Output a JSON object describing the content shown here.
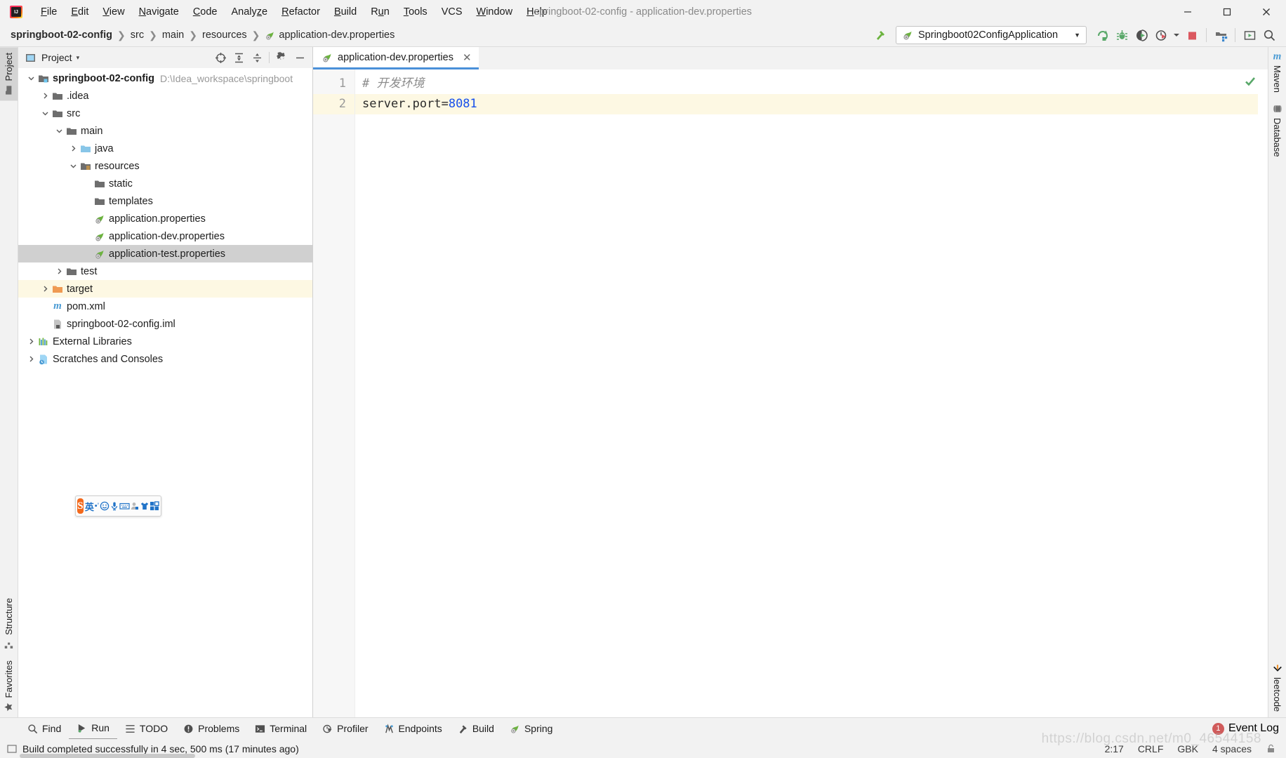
{
  "window": {
    "title": "springboot-02-config - application-dev.properties",
    "controls": {
      "minimize": "—",
      "maximize": "❐",
      "close": "✕"
    }
  },
  "menubar": [
    {
      "label": "File",
      "mnemonic": "F"
    },
    {
      "label": "Edit",
      "mnemonic": "E"
    },
    {
      "label": "View",
      "mnemonic": "V"
    },
    {
      "label": "Navigate",
      "mnemonic": "N"
    },
    {
      "label": "Code",
      "mnemonic": "C"
    },
    {
      "label": "Analyze",
      "mnemonic": "z"
    },
    {
      "label": "Refactor",
      "mnemonic": "R"
    },
    {
      "label": "Build",
      "mnemonic": "B"
    },
    {
      "label": "Run",
      "mnemonic": "u"
    },
    {
      "label": "Tools",
      "mnemonic": "T"
    },
    {
      "label": "VCS",
      "mnemonic": ""
    },
    {
      "label": "Window",
      "mnemonic": "W"
    },
    {
      "label": "Help",
      "mnemonic": "H"
    }
  ],
  "breadcrumb": [
    {
      "label": "springboot-02-config",
      "bold": true,
      "icon": ""
    },
    {
      "label": "src",
      "bold": false,
      "icon": ""
    },
    {
      "label": "main",
      "bold": false,
      "icon": ""
    },
    {
      "label": "resources",
      "bold": false,
      "icon": ""
    },
    {
      "label": "application-dev.properties",
      "bold": false,
      "icon": "spring-leaf-icon"
    }
  ],
  "toolbar": {
    "build_hammer": "build-hammer-icon",
    "run_config_name": "Springboot02ConfigApplication",
    "run_config_icon": "spring-leaf-icon",
    "dropdown_caret": "▼",
    "buttons": [
      {
        "name": "rerun-icon",
        "label": "Rerun"
      },
      {
        "name": "debug-icon",
        "label": "Debug"
      },
      {
        "name": "run-coverage-icon",
        "label": "Run with Coverage"
      },
      {
        "name": "profiler-icon",
        "label": "Profile"
      },
      {
        "name": "stop-icon",
        "label": "Stop"
      },
      {
        "name": "project-structure-icon",
        "label": "Project Structure"
      },
      {
        "name": "updates-icon",
        "label": "Updates"
      },
      {
        "name": "search-everywhere-icon",
        "label": "Search Everywhere"
      }
    ]
  },
  "left_tool_tabs": [
    {
      "label": "Project",
      "icon": "folder-icon",
      "active": true
    },
    {
      "label": "Structure",
      "icon": "structure-icon",
      "active": false
    },
    {
      "label": "Favorites",
      "icon": "star-icon",
      "active": false
    }
  ],
  "right_tool_tabs": [
    {
      "label": "Maven",
      "icon": "maven-m-icon"
    },
    {
      "label": "Database",
      "icon": "database-icon"
    },
    {
      "label": "leetcode",
      "icon": "leetcode-icon"
    }
  ],
  "project_panel": {
    "title": "Project",
    "title_caret": "▾",
    "icons": [
      {
        "name": "select-opened-file-icon"
      },
      {
        "name": "expand-all-icon"
      },
      {
        "name": "collapse-all-icon"
      },
      {
        "name": "gear-icon"
      },
      {
        "name": "hide-icon"
      }
    ],
    "tree": [
      {
        "depth": 0,
        "arrow": "down",
        "icon": "module-icon",
        "label": "springboot-02-config",
        "bold": true,
        "path": "D:\\Idea_workspace\\springboot",
        "state": ""
      },
      {
        "depth": 1,
        "arrow": "right",
        "icon": "folder-icon",
        "label": ".idea",
        "bold": false,
        "path": "",
        "state": ""
      },
      {
        "depth": 1,
        "arrow": "down",
        "icon": "folder-icon",
        "label": "src",
        "bold": false,
        "path": "",
        "state": ""
      },
      {
        "depth": 2,
        "arrow": "down",
        "icon": "folder-icon",
        "label": "main",
        "bold": false,
        "path": "",
        "state": ""
      },
      {
        "depth": 3,
        "arrow": "right",
        "icon": "source-folder-icon",
        "label": "java",
        "bold": false,
        "path": "",
        "state": ""
      },
      {
        "depth": 3,
        "arrow": "down",
        "icon": "resource-folder-icon",
        "label": "resources",
        "bold": false,
        "path": "",
        "state": ""
      },
      {
        "depth": 4,
        "arrow": "",
        "icon": "folder-icon",
        "label": "static",
        "bold": false,
        "path": "",
        "state": ""
      },
      {
        "depth": 4,
        "arrow": "",
        "icon": "folder-icon",
        "label": "templates",
        "bold": false,
        "path": "",
        "state": ""
      },
      {
        "depth": 4,
        "arrow": "",
        "icon": "spring-leaf-icon",
        "label": "application.properties",
        "bold": false,
        "path": "",
        "state": ""
      },
      {
        "depth": 4,
        "arrow": "",
        "icon": "spring-leaf-icon",
        "label": "application-dev.properties",
        "bold": false,
        "path": "",
        "state": ""
      },
      {
        "depth": 4,
        "arrow": "",
        "icon": "spring-leaf-icon",
        "label": "application-test.properties",
        "bold": false,
        "path": "",
        "state": "selected"
      },
      {
        "depth": 2,
        "arrow": "right",
        "icon": "folder-icon",
        "label": "test",
        "bold": false,
        "path": "",
        "state": ""
      },
      {
        "depth": 1,
        "arrow": "right",
        "icon": "target-folder-icon",
        "label": "target",
        "bold": false,
        "path": "",
        "state": "highlight"
      },
      {
        "depth": 1,
        "arrow": "",
        "icon": "maven-m-icon",
        "label": "pom.xml",
        "bold": false,
        "path": "",
        "state": ""
      },
      {
        "depth": 1,
        "arrow": "",
        "icon": "iml-file-icon",
        "label": "springboot-02-config.iml",
        "bold": false,
        "path": "",
        "state": ""
      },
      {
        "depth": 0,
        "arrow": "right",
        "icon": "libraries-icon",
        "label": "External Libraries",
        "bold": false,
        "path": "",
        "state": ""
      },
      {
        "depth": 0,
        "arrow": "right",
        "icon": "scratches-icon",
        "label": "Scratches and Consoles",
        "bold": false,
        "path": "",
        "state": ""
      }
    ]
  },
  "editor": {
    "tabs": [
      {
        "label": "application-dev.properties",
        "icon": "spring-leaf-icon",
        "close": "✕",
        "active": true
      }
    ],
    "inspection_status": "ok-check-icon",
    "lines": [
      {
        "number": "1",
        "current": false,
        "tokens": [
          {
            "text": "# 开发环境",
            "type": "comment"
          }
        ]
      },
      {
        "number": "2",
        "current": true,
        "tokens": [
          {
            "text": "server.port=",
            "type": "key"
          },
          {
            "text": "8081",
            "type": "num"
          }
        ]
      }
    ]
  },
  "ime": {
    "name": "sogou-input-toolbar",
    "logo": "S",
    "buttons": [
      {
        "name": "ime-language-mode",
        "glyph": "英"
      },
      {
        "name": "ime-punctuation",
        "glyph": "•,"
      },
      {
        "name": "ime-emoji-icon",
        "glyph": "☺"
      },
      {
        "name": "ime-voice-icon",
        "glyph": "⚑"
      },
      {
        "name": "ime-soft-keyboard-icon",
        "glyph": "⌸"
      },
      {
        "name": "ime-user-icon",
        "glyph": "⚬"
      },
      {
        "name": "ime-skin-icon",
        "glyph": "▼"
      },
      {
        "name": "ime-apps-icon",
        "glyph": "▦"
      }
    ]
  },
  "bottom_tabs": [
    {
      "label": "Find",
      "icon": "search-icon",
      "active": false
    },
    {
      "label": "Run",
      "icon": "run-icon",
      "active": true
    },
    {
      "label": "TODO",
      "icon": "todo-list-icon",
      "active": false
    },
    {
      "label": "Problems",
      "icon": "problems-icon",
      "active": false
    },
    {
      "label": "Terminal",
      "icon": "terminal-icon",
      "active": false
    },
    {
      "label": "Profiler",
      "icon": "profiler-icon",
      "active": false
    },
    {
      "label": "Endpoints",
      "icon": "endpoints-icon",
      "active": false
    },
    {
      "label": "Build",
      "icon": "build-hammer-icon",
      "active": false
    },
    {
      "label": "Spring",
      "icon": "spring-leaf-icon",
      "active": false
    }
  ],
  "event_log": {
    "count": "1",
    "label": "Event Log"
  },
  "statusbar": {
    "message_icon": "console-icon",
    "message": "Build completed successfully in 4 sec, 500 ms (17 minutes ago)",
    "caret_position": "2:17",
    "line_separator": "CRLF",
    "encoding": "GBK",
    "indent": "4 spaces",
    "lock_icon": "unlocked-icon"
  },
  "watermark": "https://blog.csdn.net/m0_46544158",
  "colors": {
    "accent_blue": "#4a90d9",
    "spring_green": "#6cb33f",
    "number_blue": "#1750eb",
    "comment_gray": "#8c8c8c",
    "selection_gray": "#d0d0d0",
    "highlight_cream": "#fdf8e3",
    "badge_red": "#d05b5b",
    "target_orange": "#e8a25a",
    "ime_orange": "#f3691c",
    "ime_blue": "#2073c8"
  }
}
